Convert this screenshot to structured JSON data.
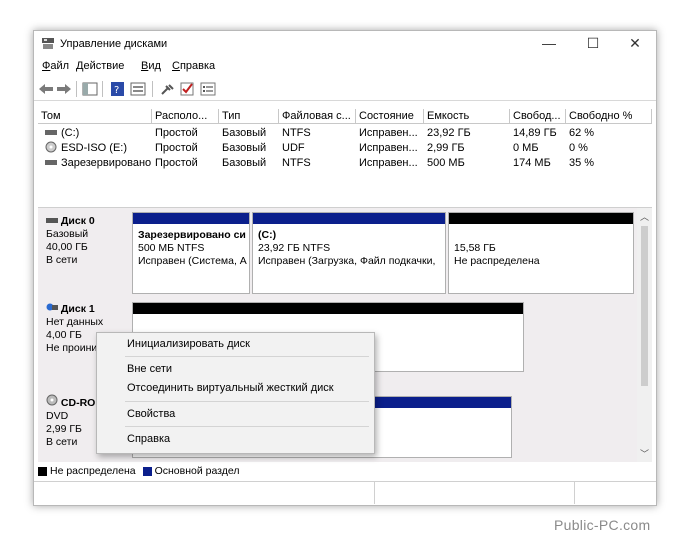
{
  "window": {
    "title": "Управление дисками",
    "minimize": "—",
    "maximize": "☐",
    "close": "✕"
  },
  "menu": [
    {
      "label": "Файл",
      "u": "Ф",
      "rest": "айл"
    },
    {
      "label": "Действие",
      "u": "Д",
      "rest": "ействие"
    },
    {
      "label": "Вид",
      "u": "В",
      "rest": "ид"
    },
    {
      "label": "Справка",
      "u": "С",
      "rest": "правка"
    }
  ],
  "toolbar": [
    "back-icon",
    "forward-icon",
    "panel-icon",
    "help-icon",
    "properties-icon",
    "connect-icon",
    "check-icon",
    "list-icon"
  ],
  "volumes": {
    "columns": [
      "Том",
      "Располо...",
      "Тип",
      "Файловая с...",
      "Состояние",
      "Емкость",
      "Свобод...",
      "Свободно %"
    ],
    "rows": [
      [
        "(C:)",
        "Простой",
        "Базовый",
        "NTFS",
        "Исправен...",
        "23,92 ГБ",
        "14,89 ГБ",
        "62 %"
      ],
      [
        "ESD-ISO (E:)",
        "Простой",
        "Базовый",
        "UDF",
        "Исправен...",
        "2,99 ГБ",
        "0 МБ",
        "0 %"
      ],
      [
        "Зарезервировано...",
        "Простой",
        "Базовый",
        "NTFS",
        "Исправен...",
        "500 МБ",
        "174 МБ",
        "35 %"
      ]
    ]
  },
  "disks": [
    {
      "name": "Диск 0",
      "lines": [
        "Базовый",
        "40,00 ГБ",
        "В сети"
      ],
      "partitions": [
        {
          "title": "Зарезервировано си",
          "l2": "500 МБ NTFS",
          "l3": "Исправен (Система, А",
          "color": "#0b1f8c"
        },
        {
          "title": "(C:)",
          "l2": "23,92 ГБ NTFS",
          "l3": "Исправен (Загрузка, Файл подкачки,",
          "color": "#0b1f8c"
        },
        {
          "title": "",
          "l2": "15,58 ГБ",
          "l3": "Не распределена",
          "color": "#000000"
        }
      ]
    },
    {
      "name": "Диск 1",
      "lines": [
        "Нет данных",
        "4,00 ГБ",
        "Не проини"
      ]
    },
    {
      "name": "CD-RO",
      "lines": [
        "DVD",
        "2,99 ГБ",
        "В сети"
      ]
    }
  ],
  "legend": [
    {
      "label": "Не распределена",
      "color": "#000000"
    },
    {
      "label": "Основной раздел",
      "color": "#0b1f8c"
    }
  ],
  "context_menu": {
    "items": [
      "Инициализировать диск",
      "Вне сети",
      "Отсоединить виртуальный жесткий диск",
      "Свойства",
      "Справка"
    ]
  },
  "watermark": "Public-PC.com"
}
